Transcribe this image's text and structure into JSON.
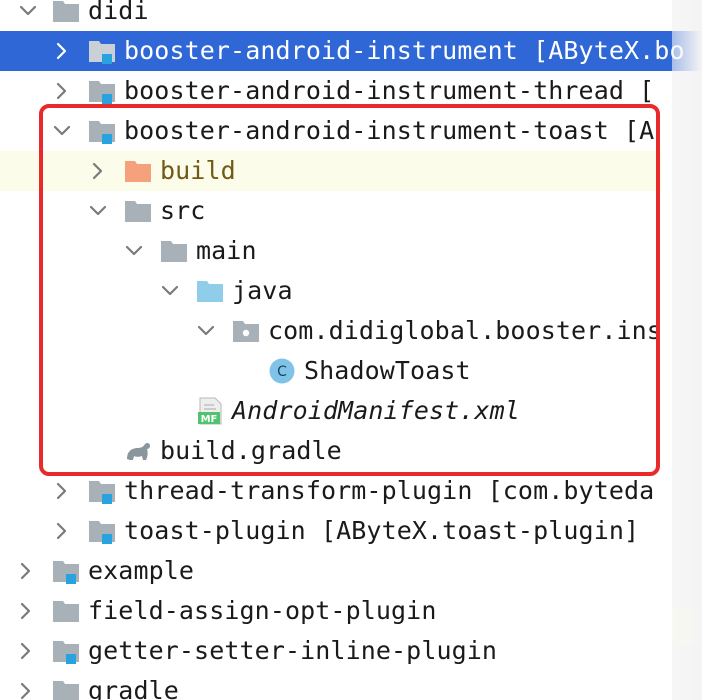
{
  "colors": {
    "selection": "#2f67d6",
    "current_line": "#fcfcea",
    "highlight_border": "#e82a2a",
    "folder": "#a9b1b8",
    "source_folder": "#8fcde9",
    "excluded_folder": "#f5a17c",
    "module_marker": "#29a3e0",
    "class_icon": "#7fc4e8"
  },
  "tree": {
    "rows": [
      {
        "label": "didi",
        "icon": "folder-icon",
        "chevron": "expanded"
      },
      {
        "label": "booster-android-instrument [AByteX.bo",
        "icon": "module-folder-icon",
        "chevron": "collapsed",
        "selected": true
      },
      {
        "label": "booster-android-instrument-thread [",
        "icon": "module-folder-icon",
        "chevron": "collapsed"
      },
      {
        "label": "booster-android-instrument-toast [A",
        "icon": "module-folder-icon",
        "chevron": "expanded"
      },
      {
        "label": "build",
        "icon": "excluded-folder-icon",
        "chevron": "collapsed"
      },
      {
        "label": "src",
        "icon": "folder-icon",
        "chevron": "expanded"
      },
      {
        "label": "main",
        "icon": "folder-icon",
        "chevron": "expanded"
      },
      {
        "label": "java",
        "icon": "source-folder-icon",
        "chevron": "expanded"
      },
      {
        "label": "com.didiglobal.booster.ins",
        "icon": "package-icon",
        "chevron": "expanded"
      },
      {
        "label": "ShadowToast",
        "icon": "class-icon"
      },
      {
        "label": "AndroidManifest.xml",
        "icon": "manifest-file-icon"
      },
      {
        "label": "build.gradle",
        "icon": "gradle-file-icon"
      },
      {
        "label": "thread-transform-plugin [com.byteda",
        "icon": "module-folder-icon",
        "chevron": "collapsed"
      },
      {
        "label": "toast-plugin [AByteX.toast-plugin]",
        "icon": "module-folder-icon",
        "chevron": "collapsed"
      },
      {
        "label": "example",
        "icon": "module-folder-icon",
        "chevron": "collapsed"
      },
      {
        "label": "field-assign-opt-plugin",
        "icon": "folder-icon",
        "chevron": "collapsed"
      },
      {
        "label": "getter-setter-inline-plugin",
        "icon": "module-folder-icon",
        "chevron": "collapsed"
      },
      {
        "label": "gradle",
        "icon": "folder-icon",
        "chevron": "collapsed"
      }
    ],
    "manifest_badge": "MF",
    "class_badge": "C"
  }
}
